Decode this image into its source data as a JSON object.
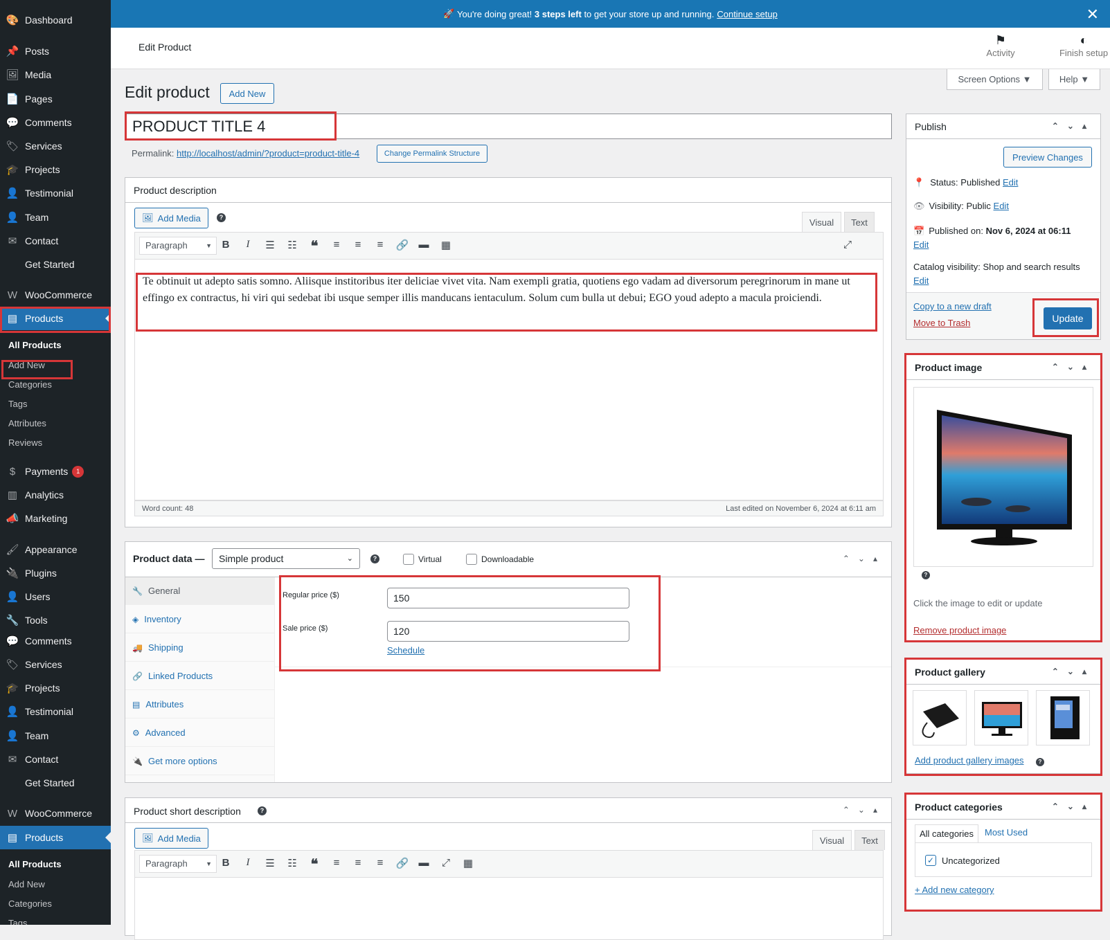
{
  "notice": {
    "rocket": "🚀",
    "text": "You're doing great!",
    "bold": "3 steps left",
    "text2": "to get your store up and running.",
    "link": "Continue setup",
    "close": "✕"
  },
  "topbar": {
    "title": "Edit Product",
    "activity_label": "Activity",
    "finish_label": "Finish setup"
  },
  "screen": {
    "screen_options": "Screen Options ▼",
    "help": "Help ▼"
  },
  "sidebar": {
    "group1": [
      {
        "label": "Dashboard",
        "icon": "🎨"
      },
      {
        "label": "Posts",
        "icon": "📌"
      },
      {
        "label": "Media",
        "icon": "🖼"
      },
      {
        "label": "Pages",
        "icon": "📄"
      },
      {
        "label": "Comments",
        "icon": "💬"
      },
      {
        "label": "Services",
        "icon": "🏷"
      },
      {
        "label": "Projects",
        "icon": "🎓"
      },
      {
        "label": "Testimonial",
        "icon": "👤"
      },
      {
        "label": "Team",
        "icon": "👤"
      },
      {
        "label": "Contact",
        "icon": "✉"
      },
      {
        "label": "Get Started",
        "icon": ""
      },
      {
        "label": "WooCommerce",
        "icon": "W"
      },
      {
        "label": "Products",
        "icon": "▤"
      }
    ],
    "products_sub": [
      "All Products",
      "Add New",
      "Categories",
      "Tags",
      "Attributes",
      "Reviews"
    ],
    "group2": [
      {
        "label": "Payments",
        "icon": "$",
        "badge": "1"
      },
      {
        "label": "Analytics",
        "icon": "▥"
      },
      {
        "label": "Marketing",
        "icon": "📣"
      },
      {
        "label": "Appearance",
        "icon": "🖌"
      },
      {
        "label": "Plugins",
        "icon": "🔌"
      },
      {
        "label": "Users",
        "icon": "👤"
      },
      {
        "label": "Tools",
        "icon": "🔧"
      },
      {
        "label": "Comments",
        "icon": "💬"
      },
      {
        "label": "Services",
        "icon": "🏷"
      },
      {
        "label": "Projects",
        "icon": "🎓"
      },
      {
        "label": "Testimonial",
        "icon": "👤"
      },
      {
        "label": "Team",
        "icon": "👤"
      },
      {
        "label": "Contact",
        "icon": "✉"
      },
      {
        "label": "Get Started",
        "icon": ""
      },
      {
        "label": "WooCommerce",
        "icon": "W"
      },
      {
        "label": "Products",
        "icon": "▤"
      }
    ],
    "products_sub2": [
      "All Products",
      "Add New",
      "Categories",
      "Tags"
    ]
  },
  "page": {
    "heading": "Edit product",
    "add_new": "Add New",
    "product_title": "PRODUCT TITLE 4",
    "permalink_label": "Permalink:",
    "permalink_url": "http://localhost/admin/?product=product-title-4",
    "change_permalink": "Change Permalink Structure"
  },
  "description": {
    "title": "Product description",
    "add_media": "Add Media",
    "help_icon": "?",
    "tab_visual": "Visual",
    "tab_text": "Text",
    "format": "Paragraph",
    "content": "Te obtinuit ut adepto satis somno. Aliisque institoribus iter deliciae vivet vita. Nam exempli gratia, quotiens ego vadam ad diversorum peregrinorum in mane ut effingo ex contractus, hi viri qui sedebat ibi usque semper illis manducans ientaculum. Solum cum bulla ut debui; EGO youd adepto a macula proiciendi.",
    "word_count": "Word count: 48",
    "last_edited": "Last edited on November 6, 2024 at 6:11 am"
  },
  "product_data": {
    "title": "Product data —",
    "type": "Simple product",
    "virtual": "Virtual",
    "downloadable": "Downloadable",
    "tabs": [
      "General",
      "Inventory",
      "Shipping",
      "Linked Products",
      "Attributes",
      "Advanced",
      "Get more options"
    ],
    "regular_price_label": "Regular price ($)",
    "regular_price": "150",
    "sale_price_label": "Sale price ($)",
    "sale_price": "120",
    "schedule": "Schedule"
  },
  "short_description": {
    "title": "Product short description",
    "add_media": "Add Media",
    "tab_visual": "Visual",
    "tab_text": "Text",
    "format": "Paragraph"
  },
  "publish": {
    "title": "Publish",
    "preview": "Preview Changes",
    "status_label": "Status:",
    "status": "Published",
    "edit": "Edit",
    "visibility_label": "Visibility:",
    "visibility": "Public",
    "published_on_label": "Published on:",
    "published_on": "Nov 6, 2024 at 06:11",
    "catalog_label": "Catalog visibility:",
    "catalog": "Shop and search results",
    "copy_draft": "Copy to a new draft",
    "trash": "Move to Trash",
    "update": "Update"
  },
  "product_image": {
    "title": "Product image",
    "hint": "Click the image to edit or update",
    "remove": "Remove product image"
  },
  "gallery": {
    "title": "Product gallery",
    "add": "Add product gallery images"
  },
  "categories": {
    "title": "Product categories",
    "tab_all": "All categories",
    "tab_used": "Most Used",
    "item": "Uncategorized",
    "add": "+ Add new category"
  }
}
